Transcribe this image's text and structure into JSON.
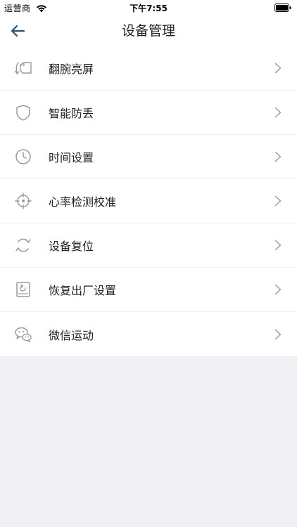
{
  "status_bar": {
    "carrier": "运营商",
    "time": "下午7:55"
  },
  "nav": {
    "title": "设备管理",
    "back_icon": "arrow-left-icon"
  },
  "settings": {
    "items": [
      {
        "label": "翻腕亮屏",
        "icon": "wrist-flip-icon"
      },
      {
        "label": "智能防丢",
        "icon": "shield-icon"
      },
      {
        "label": "时间设置",
        "icon": "clock-icon"
      },
      {
        "label": "心率检测校准",
        "icon": "crosshair-icon"
      },
      {
        "label": "设备复位",
        "icon": "reset-arrows-icon"
      },
      {
        "label": "恢复出厂设置",
        "icon": "factory-reset-icon"
      },
      {
        "label": "微信运动",
        "icon": "wechat-icon"
      }
    ]
  },
  "colors": {
    "background": "#efeff4",
    "surface": "#ffffff",
    "icon": "#9a9a9a",
    "chevron": "#9b9b9b",
    "text": "#222222",
    "back_arrow": "#2d4f6b"
  }
}
